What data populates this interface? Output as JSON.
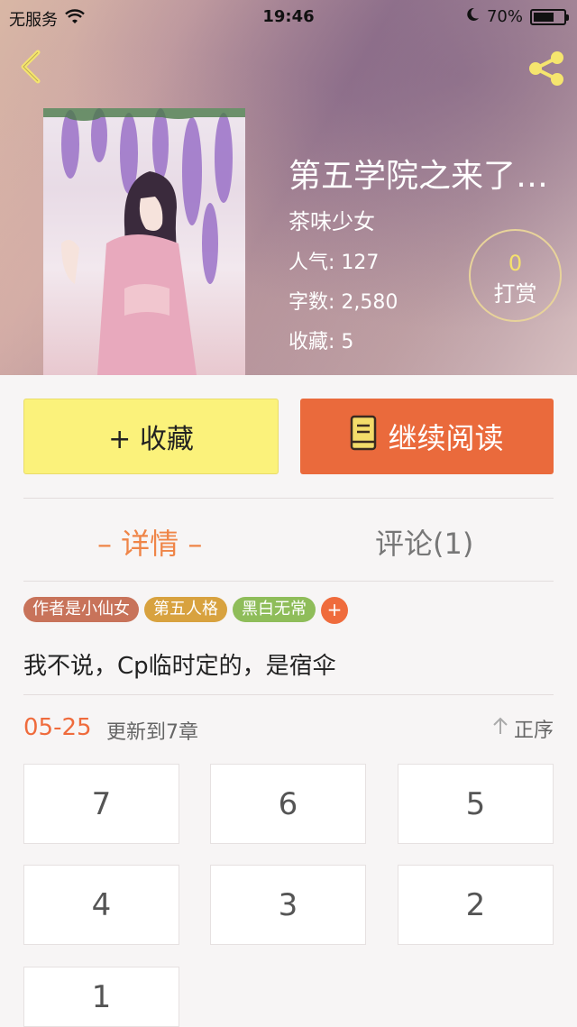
{
  "status": {
    "carrier": "无服务",
    "time": "19:46",
    "battery": "70%",
    "battery_level": 0.7
  },
  "book": {
    "title": "第五学院之来了…",
    "author": "茶味少女",
    "popularity_label": "人气: ",
    "popularity": "127",
    "words_label": "字数: ",
    "words": "2,580",
    "favorites_label": "收藏: ",
    "favorites": "5"
  },
  "reward": {
    "count": "0",
    "label": "打赏"
  },
  "actions": {
    "favorite": "+ 收藏",
    "continue_read": "继续阅读"
  },
  "tabs": {
    "detail": "– 详情 –",
    "comments": "评论(1)"
  },
  "tags": [
    {
      "label": "作者是小仙女",
      "color": "#c8735a"
    },
    {
      "label": "第五人格",
      "color": "#d8a23f"
    },
    {
      "label": "黑白无常",
      "color": "#8fbd5a"
    }
  ],
  "tag_add": "+",
  "description": "我不说，Cp临时定的，是宿伞",
  "update": {
    "date": "05-25",
    "text": "更新到7章",
    "order": "正序"
  },
  "chapters": [
    "7",
    "6",
    "5",
    "4",
    "3",
    "2",
    "1"
  ]
}
